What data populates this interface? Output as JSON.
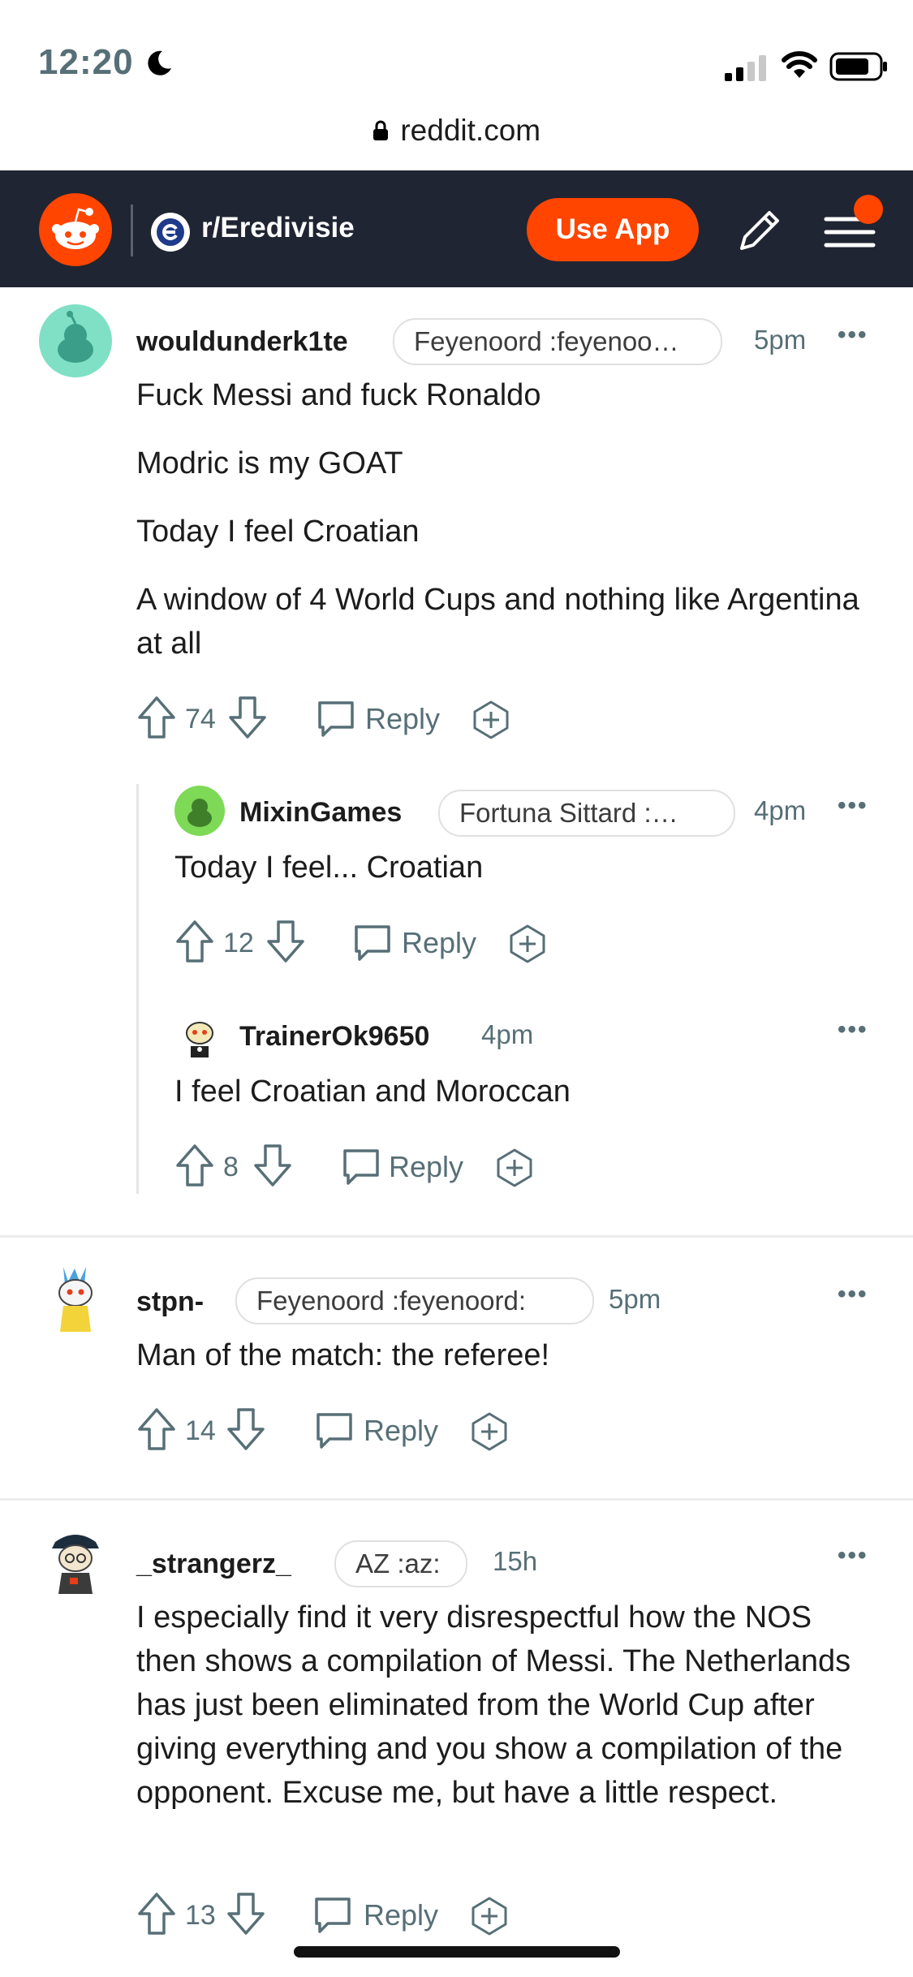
{
  "status_bar": {
    "time": "12:20",
    "url": "reddit.com"
  },
  "header": {
    "subreddit": "r/Eredivisie",
    "use_app_label": "Use App"
  },
  "comments": [
    {
      "username": "wouldunderk1te",
      "flair": "Feyenoord :feyenoo…",
      "time": "5pm",
      "paragraphs": [
        "Fuck Messi and fuck Ronaldo",
        "Modric is my GOAT",
        "Today I feel Croatian",
        "A window of 4 World Cups and nothing like Argentina at all"
      ],
      "score": "74",
      "reply_label": "Reply"
    },
    {
      "username": "MixinGames",
      "flair": "Fortuna Sittard :…",
      "time": "4pm",
      "paragraphs": [
        "Today I feel... Croatian"
      ],
      "score": "12",
      "reply_label": "Reply"
    },
    {
      "username": "TrainerOk9650",
      "flair": "",
      "time": "4pm",
      "paragraphs": [
        "I feel Croatian and Moroccan"
      ],
      "score": "8",
      "reply_label": "Reply"
    },
    {
      "username": "stpn-",
      "flair": "Feyenoord :feyenoord:",
      "time": "5pm",
      "paragraphs": [
        "Man of the match: the referee!"
      ],
      "score": "14",
      "reply_label": "Reply"
    },
    {
      "username": "_strangerz_",
      "flair": "AZ :az:",
      "time": "15h",
      "paragraphs": [
        "I especially find it very disrespectful how the NOS then shows a compilation of Messi. The Netherlands has just been eliminated from the World Cup after giving everything and you show a compilation of the opponent. Excuse me, but have a little respect."
      ],
      "score": "13",
      "reply_label": "Reply"
    }
  ],
  "colors": {
    "accent": "#ff4500",
    "header_bg": "#1f2532",
    "meta": "#576f76"
  }
}
